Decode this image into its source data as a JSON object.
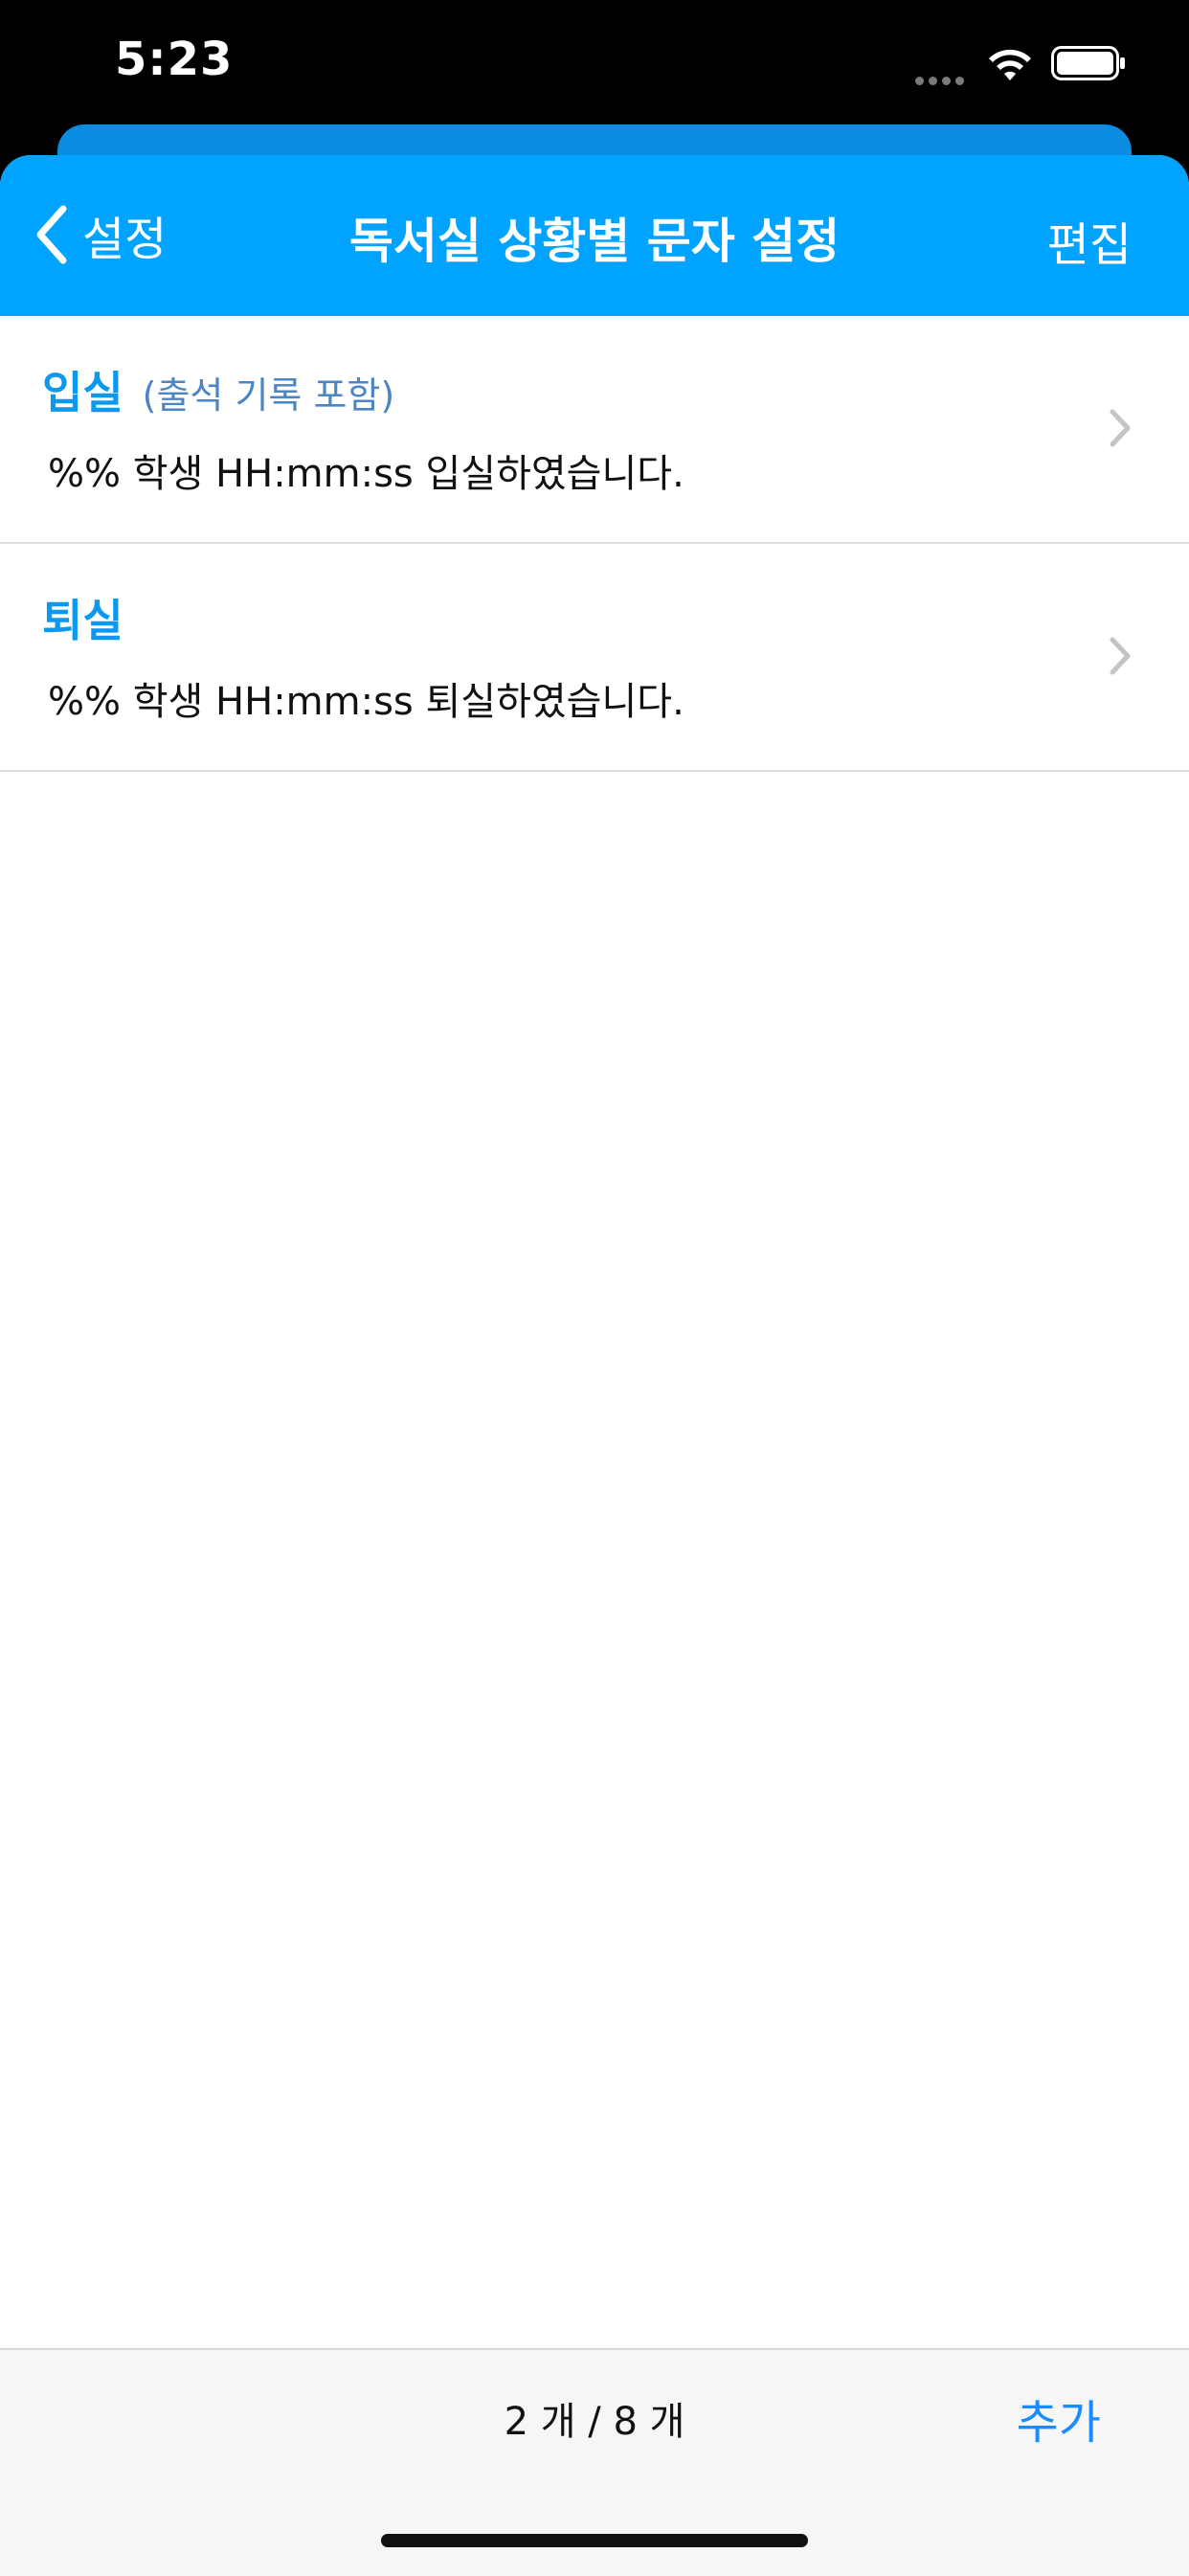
{
  "status_bar": {
    "time": "5:23",
    "icons": [
      "cellular-dots-icon",
      "wifi-icon",
      "battery-icon"
    ]
  },
  "navbar": {
    "back_label": "설정",
    "title": "독서실 상황별 문자 설정",
    "edit_label": "편집",
    "back_icon": "chevron-left-icon"
  },
  "colors": {
    "navbar_bg": "#00a3ff",
    "accent": "#0b98ee",
    "subtitle": "#4b85c6",
    "toolbar_button": "#1a8cff"
  },
  "list": {
    "items": [
      {
        "name": "입실",
        "subtitle": "(출석 기록 포함)",
        "message": "%% 학생 HH:mm:ss 입실하였습니다."
      },
      {
        "name": "퇴실",
        "subtitle": "",
        "message": "%% 학생 HH:mm:ss 퇴실하였습니다."
      }
    ]
  },
  "toolbar": {
    "count": "2 개 / 8 개",
    "add_label": "추가"
  }
}
